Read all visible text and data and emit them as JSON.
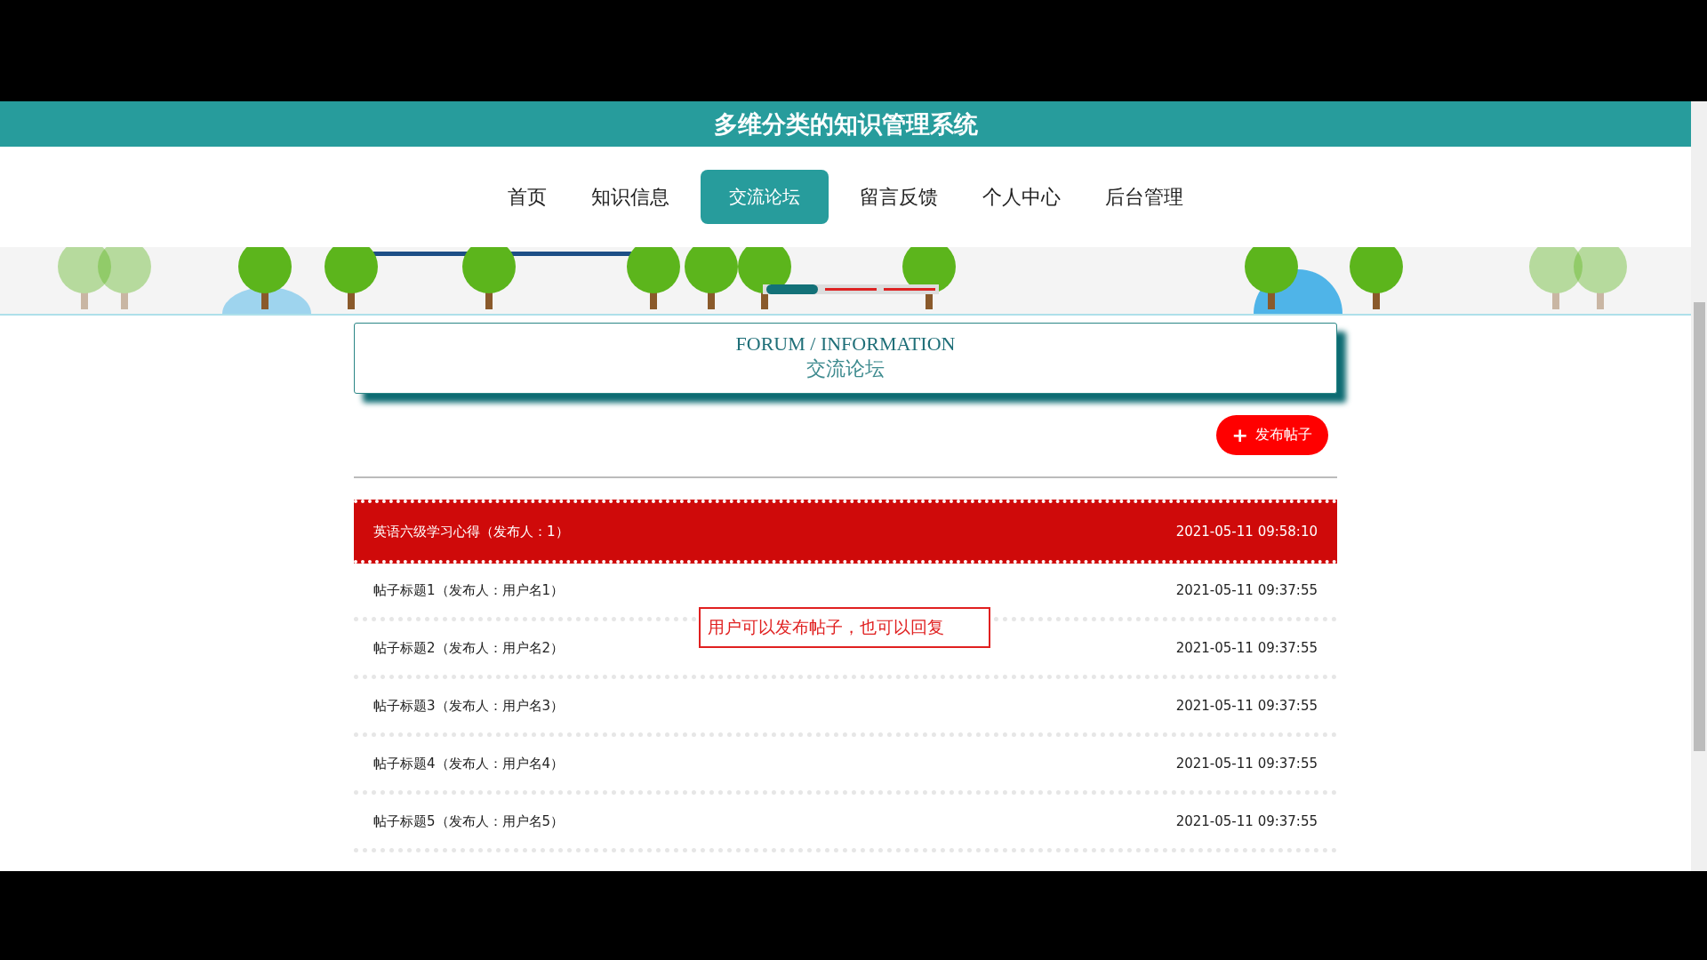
{
  "header": {
    "title": "多维分类的知识管理系统"
  },
  "nav": [
    {
      "label": "首页",
      "selected": false
    },
    {
      "label": "知识信息",
      "selected": false
    },
    {
      "label": "交流论坛",
      "selected": true
    },
    {
      "label": "留言反馈",
      "selected": false
    },
    {
      "label": "个人中心",
      "selected": false
    },
    {
      "label": "后台管理",
      "selected": false
    }
  ],
  "banner": {
    "kind": "picture",
    "indicators": [
      {
        "selected": true
      },
      {
        "selected": false
      },
      {
        "selected": false
      }
    ]
  },
  "section": {
    "title_en": "FORUM / INFORMATION",
    "title_cn": "交流论坛"
  },
  "post_button": {
    "icon": "+",
    "label": "发布帖子"
  },
  "posts": [
    {
      "title": "英语六级学习心得（发布人：1）",
      "time": "2021-05-11 09:58:10",
      "selected": true
    },
    {
      "title": "帖子标题1（发布人：用户名1）",
      "time": "2021-05-11 09:37:55",
      "selected": false
    },
    {
      "title": "帖子标题2（发布人：用户名2）",
      "time": "2021-05-11 09:37:55",
      "selected": false
    },
    {
      "title": "帖子标题3（发布人：用户名3）",
      "time": "2021-05-11 09:37:55",
      "selected": false
    },
    {
      "title": "帖子标题4（发布人：用户名4）",
      "time": "2021-05-11 09:37:55",
      "selected": false
    },
    {
      "title": "帖子标题5（发布人：用户名5）",
      "time": "2021-05-11 09:37:55",
      "selected": false
    }
  ],
  "annotation": {
    "text": "用户可以发布帖子，也可以回复"
  }
}
